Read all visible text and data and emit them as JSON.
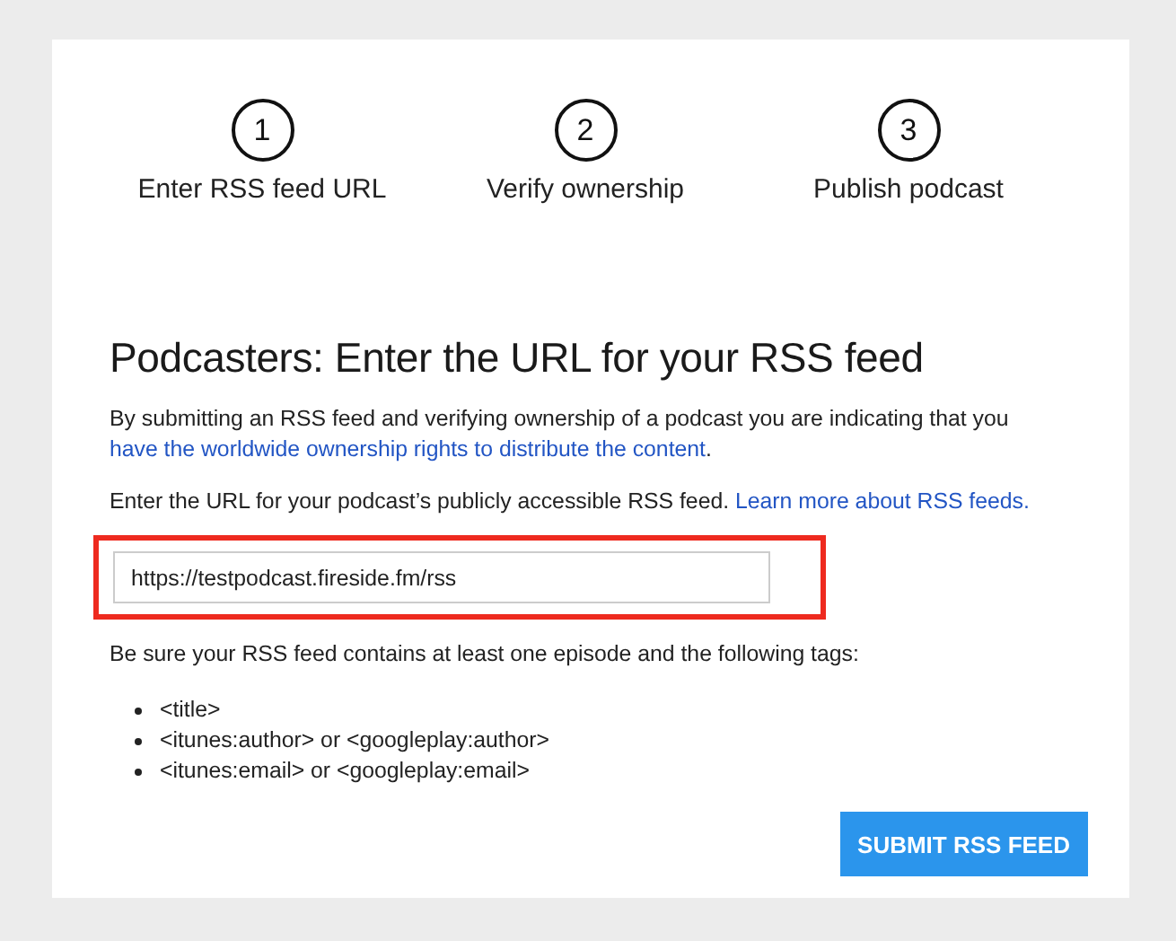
{
  "steps": [
    {
      "number": "1",
      "label": "Enter RSS feed URL"
    },
    {
      "number": "2",
      "label": "Verify ownership"
    },
    {
      "number": "3",
      "label": "Publish podcast"
    }
  ],
  "heading": "Podcasters: Enter the URL for your RSS feed",
  "intro": {
    "text": "By submitting an RSS feed and verifying ownership of a podcast you are indicating that you",
    "link": "have the worldwide ownership rights to distribute the content",
    "after": "."
  },
  "url_prompt": {
    "text": "Enter the URL for your podcast’s publicly accessible RSS feed.",
    "link": "Learn more about RSS feeds."
  },
  "url_field": {
    "value": "https://testpodcast.fireside.fm/rss",
    "highlighted": true
  },
  "requirements": "Be sure your RSS feed contains at least one episode and the following tags:",
  "tags": [
    "<title>",
    "<itunes:author> or <googleplay:author>",
    "<itunes:email> or <googleplay:email>"
  ],
  "submit_button": "SUBMIT RSS FEED"
}
